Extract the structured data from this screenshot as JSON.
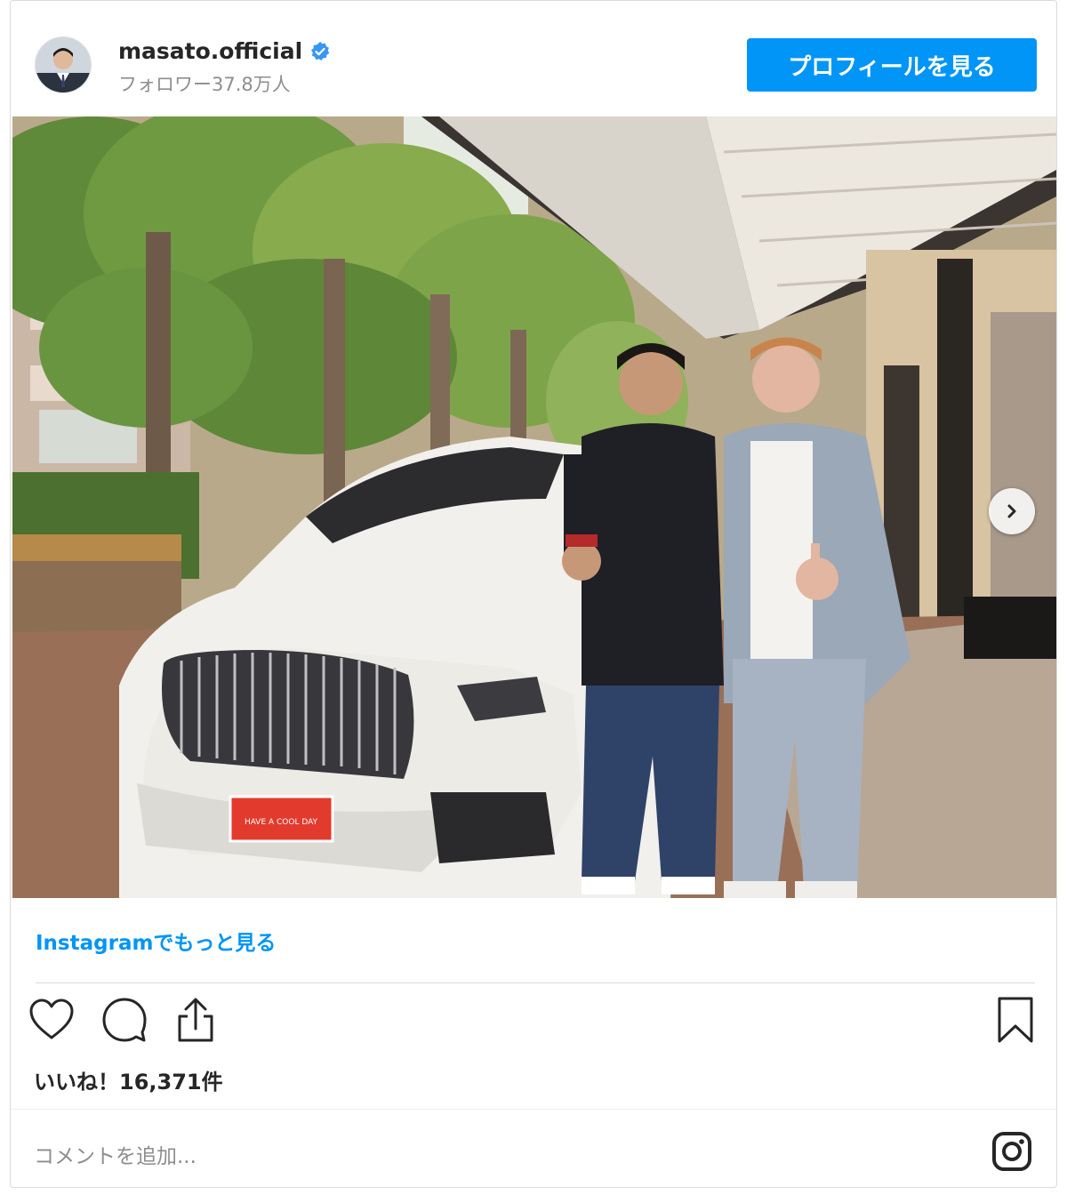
{
  "header": {
    "username": "masato.official",
    "followers": "フォロワー37.8万人",
    "profile_button": "プロフィールを見る"
  },
  "photo": {
    "plate_text": "HAVE A COOL DAY"
  },
  "more_link": "Instagramでもっと見る",
  "likes": "いいね！16,371件",
  "comment_placeholder": "コメントを追加...",
  "colors": {
    "accent": "#0095f6",
    "text": "#262626",
    "muted": "#8e8e8e"
  },
  "icons": [
    "verified-badge-icon",
    "heart-icon",
    "comment-icon",
    "share-icon",
    "bookmark-icon",
    "instagram-icon",
    "chevron-right-icon"
  ]
}
